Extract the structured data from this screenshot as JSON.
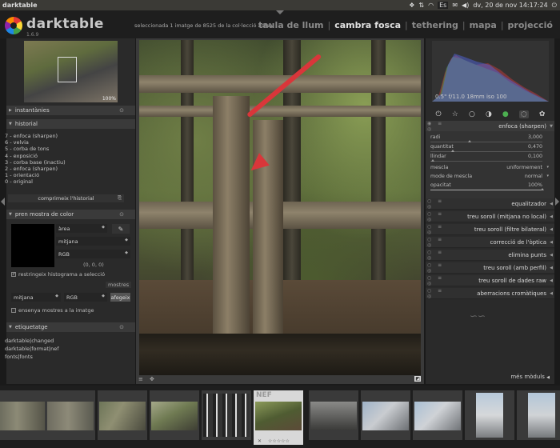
{
  "os": {
    "app_name": "darktable",
    "datetime": "dv, 20 de nov 14:17:24",
    "tray_icons": [
      "dropbox-icon",
      "updown-arrows-icon",
      "wifi-icon",
      "keyboard-layout-icon",
      "mail-icon",
      "volume-icon",
      "power-icon"
    ],
    "keyboard_label": "Es"
  },
  "header": {
    "app_title": "darktable",
    "version": "1.6.9",
    "selection_info": "seleccionada 1 imatge de 8525 de la col·lecció actual",
    "views": [
      "taula de llum",
      "cambra fosca",
      "tethering",
      "mapa",
      "projecció"
    ],
    "active_view": "cambra fosca",
    "separator": "|"
  },
  "left": {
    "navigation": {
      "zoom": "100%"
    },
    "snapshots": {
      "title": "instantànies"
    },
    "history": {
      "title": "historial",
      "items": [
        "7 - enfoca (sharpen)",
        "6 - velvia",
        "5 - corba de tons",
        "4 - exposició",
        "3 - corba base (inactiu)",
        "2 - enfoca (sharpen)",
        "1 - orientació",
        "0 - original"
      ],
      "compress_label": "comprimeix l'historial"
    },
    "color_picker": {
      "title": "pren mostra de color",
      "area_select": "àrea",
      "stat_select": "mitjana",
      "model_select": "RGB",
      "values": "(0, 0, 0)",
      "restrict_label": "restringeix histograma a selecció",
      "samples_label": "mostres",
      "sample_stat_select": "mitjana",
      "sample_model_select": "RGB",
      "add_label": "afegeix",
      "show_samples_label": "ensenya mostres a la imatge"
    },
    "tagging": {
      "title": "etiquetatge",
      "tags": [
        "darktable|changed",
        "darktable|format|nef",
        "fonts|fonts"
      ]
    }
  },
  "right": {
    "exif": "0.5\" f/11.0 18mm iso 100",
    "module_group_icons": [
      "power-icon",
      "star-icon",
      "circle-icon",
      "half-circle-icon",
      "color-circle-icon",
      "correct-icon",
      "effect-icon"
    ],
    "active_module": {
      "title": "enfoca (sharpen)",
      "params": [
        {
          "name": "radi",
          "value": "3,000",
          "level": 0.35
        },
        {
          "name": "quantitat",
          "value": "0,470",
          "level": 0.2
        },
        {
          "name": "llindar",
          "value": "0,100",
          "level": 0.02
        }
      ],
      "blend_options": [
        {
          "name": "mescla",
          "value": "uniformement"
        },
        {
          "name": "mode de mescla",
          "value": "normal"
        }
      ],
      "opacity": {
        "name": "opacitat",
        "value": "100%",
        "level": 1.0
      }
    },
    "modules": [
      "equalitzador",
      "treu soroll (mitjana no local)",
      "treu soroll (filtre bilateral)",
      "correcció de l'òptica",
      "elimina punts",
      "treu soroll (amb perfil)",
      "treu soroll de dades raw",
      "aberracions cromàtiques"
    ],
    "more_modules": "més mòduls"
  },
  "filmstrip": {
    "active_ext": "NEF",
    "rating": "☆☆☆☆☆",
    "reject": "✕"
  }
}
